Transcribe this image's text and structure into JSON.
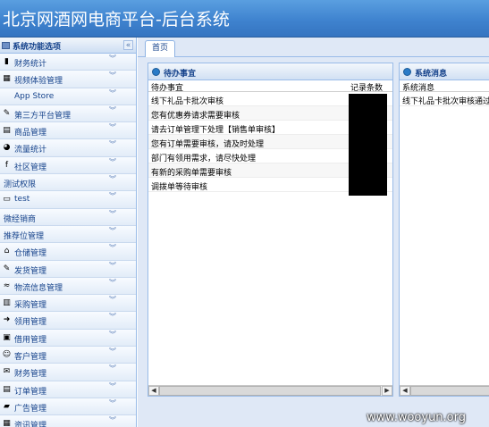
{
  "header": {
    "title": "北京网酒网电商平台-后台系统"
  },
  "sidebar": {
    "title": "系统功能选项",
    "collapse_glyph": "«",
    "items": [
      {
        "label": "财务统计",
        "icon": "bar-chart-icon",
        "glyph": "▮"
      },
      {
        "label": "视频体验管理",
        "icon": "film-icon",
        "glyph": "▦"
      },
      {
        "label": "App Store",
        "icon": "app-store-icon",
        "glyph": ""
      },
      {
        "label": "第三方平台管理",
        "icon": "tools-icon",
        "glyph": "✎"
      },
      {
        "label": "商品管理",
        "icon": "goods-icon",
        "glyph": "▤"
      },
      {
        "label": "流量统计",
        "icon": "pie-chart-icon",
        "glyph": "◕"
      },
      {
        "label": "社区管理",
        "icon": "facebook-icon",
        "glyph": "f"
      },
      {
        "label": "测试权限",
        "icon": "",
        "glyph": ""
      },
      {
        "label": "test",
        "icon": "monitor-icon",
        "glyph": "▭"
      },
      {
        "label": "微经销商",
        "icon": "",
        "glyph": ""
      },
      {
        "label": "推荐位管理",
        "icon": "",
        "glyph": ""
      },
      {
        "label": "仓储管理",
        "icon": "warehouse-icon",
        "glyph": "⌂"
      },
      {
        "label": "发货管理",
        "icon": "truck-icon",
        "glyph": "✎"
      },
      {
        "label": "物流信息管理",
        "icon": "logistics-icon",
        "glyph": "≈"
      },
      {
        "label": "采购管理",
        "icon": "purchase-icon",
        "glyph": "▥"
      },
      {
        "label": "领用管理",
        "icon": "arrow-icon",
        "glyph": "➜"
      },
      {
        "label": "借用管理",
        "icon": "borrow-icon",
        "glyph": "▣"
      },
      {
        "label": "客户管理",
        "icon": "user-icon",
        "glyph": "☺"
      },
      {
        "label": "财务管理",
        "icon": "envelope-icon",
        "glyph": "✉"
      },
      {
        "label": "订单管理",
        "icon": "order-icon",
        "glyph": "▤"
      },
      {
        "label": "广告管理",
        "icon": "ad-icon",
        "glyph": "▰"
      },
      {
        "label": "资讯管理",
        "icon": "news-icon",
        "glyph": "▦"
      }
    ],
    "chevron": "︾"
  },
  "tabs": [
    {
      "label": "首页"
    }
  ],
  "todo_panel": {
    "title": "待办事宜",
    "col1_header": "待办事宜",
    "col2_header": "记录条数",
    "rows": [
      "线下礼品卡批次审核",
      "您有优惠券请求需要审核",
      "请去订单管理下处理【销售单审核】",
      "您有订单需要审核，请及时处理",
      "部门有领用需求，请尽快处理",
      "有新的采购单需要审核",
      "调拨单等待审核"
    ]
  },
  "message_panel": {
    "title": "系统消息",
    "col1_header": "系统消息",
    "rows": [
      "线下礼品卡批次审核通过"
    ]
  },
  "scroll": {
    "left_glyph": "◀",
    "right_glyph": "▶"
  },
  "watermark": "www.wooyun.org",
  "colors": {
    "header_bg": "#3f83cf",
    "panel_border": "#99bbe8",
    "menu_text": "#15428b",
    "content_bg": "#dfe8f6"
  }
}
